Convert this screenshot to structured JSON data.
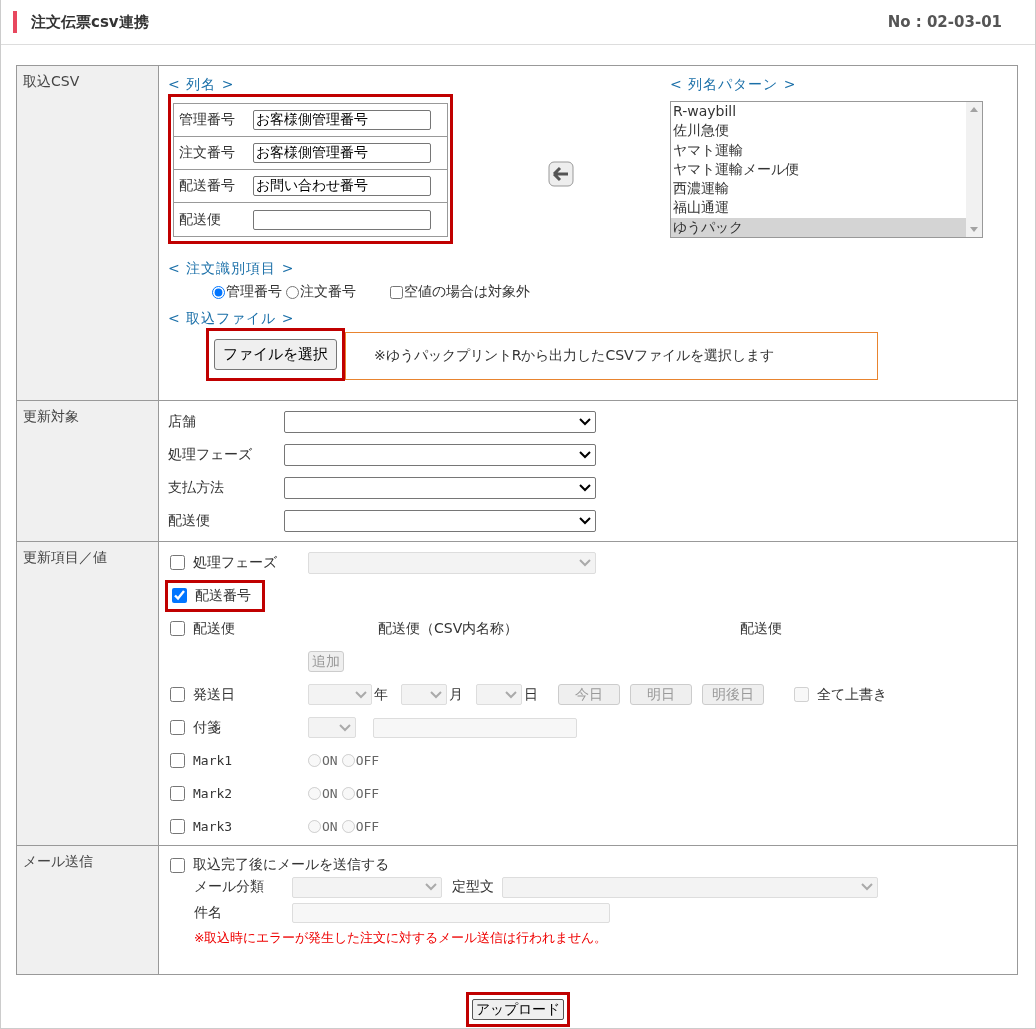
{
  "header": {
    "title": "注文伝票csv連携",
    "page_no": "No : 02-03-01"
  },
  "import_csv": {
    "label": "取込CSV",
    "column_names": {
      "heading": "< 列名 >",
      "highlighted": true,
      "fields": [
        {
          "label": "管理番号",
          "value": "お客様側管理番号"
        },
        {
          "label": "注文番号",
          "value": "お客様側管理番号"
        },
        {
          "label": "配送番号",
          "value": "お問い合わせ番号"
        },
        {
          "label": "配送便"
        }
      ]
    },
    "pattern": {
      "heading": "< 列名パターン >",
      "options": [
        {
          "label": "R-waybill",
          "selected": false
        },
        {
          "label": "佐川急便",
          "selected": false
        },
        {
          "label": "ヤマト運輸",
          "selected": false
        },
        {
          "label": "ヤマト運輸メール便",
          "selected": false
        },
        {
          "label": "西濃運輸",
          "selected": false
        },
        {
          "label": "福山通運",
          "selected": false
        },
        {
          "label": "ゆうパック",
          "selected": true
        }
      ]
    },
    "order_key": {
      "heading": "< 注文識別項目 >",
      "options": [
        {
          "label": "管理番号",
          "selected": true
        },
        {
          "label": "注文番号",
          "selected": false
        }
      ],
      "skip_empty": {
        "label": "空値の場合は対象外",
        "checked": false
      }
    },
    "file": {
      "heading": "< 取込ファイル >",
      "button": "ファイルを選択",
      "highlighted": true,
      "note": "※ゆうパックプリントRから出力したCSVファイルを選択します"
    }
  },
  "update_target": {
    "label": "更新対象",
    "filters": [
      {
        "label": "店舗"
      },
      {
        "label": "処理フェーズ"
      },
      {
        "label": "支払方法"
      },
      {
        "label": "配送便"
      }
    ]
  },
  "update_items": {
    "label": "更新項目／値",
    "rows": [
      {
        "kind": "select",
        "label": "処理フェーズ",
        "checked": false
      },
      {
        "kind": "plain",
        "label": "配送番号",
        "checked": true,
        "highlighted": true
      },
      {
        "kind": "carrier",
        "label": "配送便",
        "checked": false,
        "columns": [
          "配送便（CSV内名称）",
          "配送便"
        ],
        "add_button": "追加"
      },
      {
        "kind": "date",
        "label": "発送日",
        "checked": false,
        "units": [
          "年",
          "月",
          "日"
        ],
        "buttons": [
          "今日",
          "明日",
          "明後日"
        ],
        "overwrite": {
          "label": "全て上書き",
          "checked": false
        }
      },
      {
        "kind": "sticky",
        "label": "付箋",
        "checked": false
      },
      {
        "kind": "mark",
        "label": "Mark1",
        "checked": false,
        "options": [
          {
            "label": "ON",
            "selected": false
          },
          {
            "label": "OFF",
            "selected": false
          }
        ]
      },
      {
        "kind": "mark",
        "label": "Mark2",
        "checked": false,
        "options": [
          {
            "label": "ON",
            "selected": false
          },
          {
            "label": "OFF",
            "selected": false
          }
        ]
      },
      {
        "kind": "mark",
        "label": "Mark3",
        "checked": false,
        "options": [
          {
            "label": "ON",
            "selected": false
          },
          {
            "label": "OFF",
            "selected": false
          }
        ]
      }
    ]
  },
  "mail": {
    "label": "メール送信",
    "send": {
      "label": "取込完了後にメールを送信する",
      "checked": false
    },
    "category_label": "メール分類",
    "template_label": "定型文",
    "subject_label": "件名",
    "warning": "※取込時にエラーが発生した注文に対するメール送信は行われません。"
  },
  "upload": {
    "label": "アップロード",
    "highlighted": true
  }
}
